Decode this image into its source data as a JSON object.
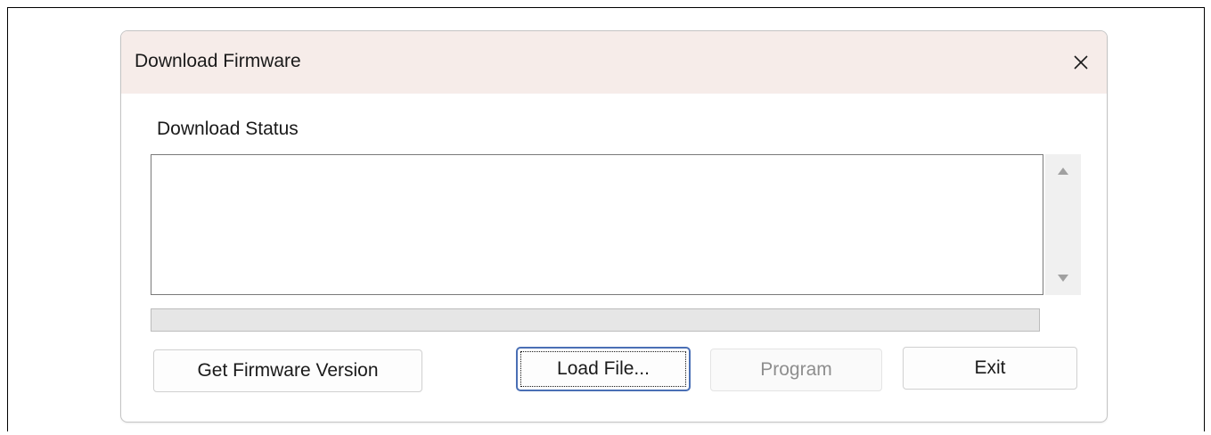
{
  "dialog": {
    "title": "Download Firmware",
    "close_icon": "close-icon"
  },
  "status": {
    "label": "Download Status",
    "text": "",
    "scroll_up_icon": "triangle-up-icon",
    "scroll_down_icon": "triangle-down-icon"
  },
  "progress": {
    "value_percent": 0
  },
  "buttons": {
    "get_firmware_version": "Get Firmware Version",
    "load_file": "Load File...",
    "program": "Program",
    "exit": "Exit"
  },
  "state": {
    "program_enabled": false,
    "focused_button": "load_file"
  },
  "colors": {
    "titlebar": "#f6ece9",
    "focus_border": "#4a6fb5",
    "disabled_text": "#8e8e8e",
    "progress_fill": "#06b025"
  }
}
